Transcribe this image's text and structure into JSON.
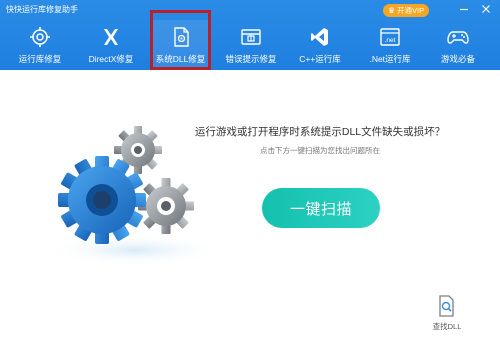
{
  "app": {
    "title": "快快运行库修复助手"
  },
  "titlebar": {
    "vip_label": "开通VIP",
    "vip_icon": "crown-icon",
    "min_icon": "minimize-icon",
    "close_icon": "close-icon"
  },
  "nav": {
    "active_index": 2,
    "items": [
      {
        "label": "运行库修复",
        "icon": "target-icon"
      },
      {
        "label": "DirectX修复",
        "icon": "directx-x-icon"
      },
      {
        "label": "系统DLL修复",
        "icon": "dll-file-icon"
      },
      {
        "label": "错误提示修复",
        "icon": "error-window-icon"
      },
      {
        "label": "C++运行库",
        "icon": "visual-studio-icon"
      },
      {
        "label": ".Net运行库",
        "icon": "net-framework-icon"
      },
      {
        "label": "游戏必备",
        "icon": "gamepad-icon"
      }
    ]
  },
  "main": {
    "headline": "运行游戏或打开程序时系统提示DLL文件缺失或损坏？",
    "subline": "点击下方一键扫描为您找出问题所在",
    "scan_label": "一键扫描",
    "find_dll_label": "查找DLL",
    "find_dll_icon": "search-file-icon"
  },
  "colors": {
    "header_blue": "#1f7fe0",
    "vip_orange": "#f5a623",
    "active_frame": "#b8202a",
    "scan_teal": "#14c0ae",
    "gear_blue": "#2a86d8",
    "gear_gray": "#8d9399"
  }
}
